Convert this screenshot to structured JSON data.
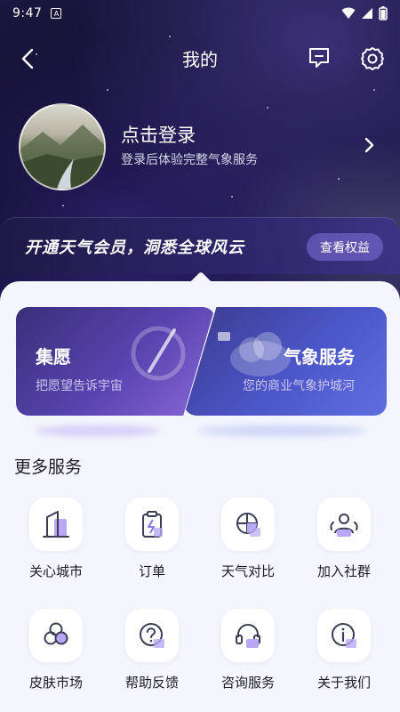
{
  "status_bar": {
    "time": "9:47",
    "sim_label": "A"
  },
  "header": {
    "title": "我的"
  },
  "profile": {
    "login_title": "点击登录",
    "login_subtitle": "登录后体验完整气象服务"
  },
  "vip": {
    "text": "开通天气会员，洞悉全球风云",
    "button": "查看权益"
  },
  "cards": [
    {
      "title": "集愿",
      "subtitle": "把愿望告诉宇宙"
    },
    {
      "title": "气象服务",
      "subtitle": "您的商业气象护城河"
    }
  ],
  "more_services": {
    "title": "更多服务",
    "items": [
      {
        "label": "关心城市",
        "icon": "building-icon"
      },
      {
        "label": "订单",
        "icon": "clipboard-icon"
      },
      {
        "label": "天气对比",
        "icon": "globe-compare-icon"
      },
      {
        "label": "加入社群",
        "icon": "community-icon"
      },
      {
        "label": "皮肤市场",
        "icon": "skin-icon"
      },
      {
        "label": "帮助反馈",
        "icon": "help-icon"
      },
      {
        "label": "咨询服务",
        "icon": "headset-icon"
      },
      {
        "label": "关于我们",
        "icon": "info-icon"
      }
    ]
  },
  "colors": {
    "accent": "#6b57d6",
    "panel_bg": "#f3f6fc",
    "icon_outline": "#3a3d55"
  }
}
